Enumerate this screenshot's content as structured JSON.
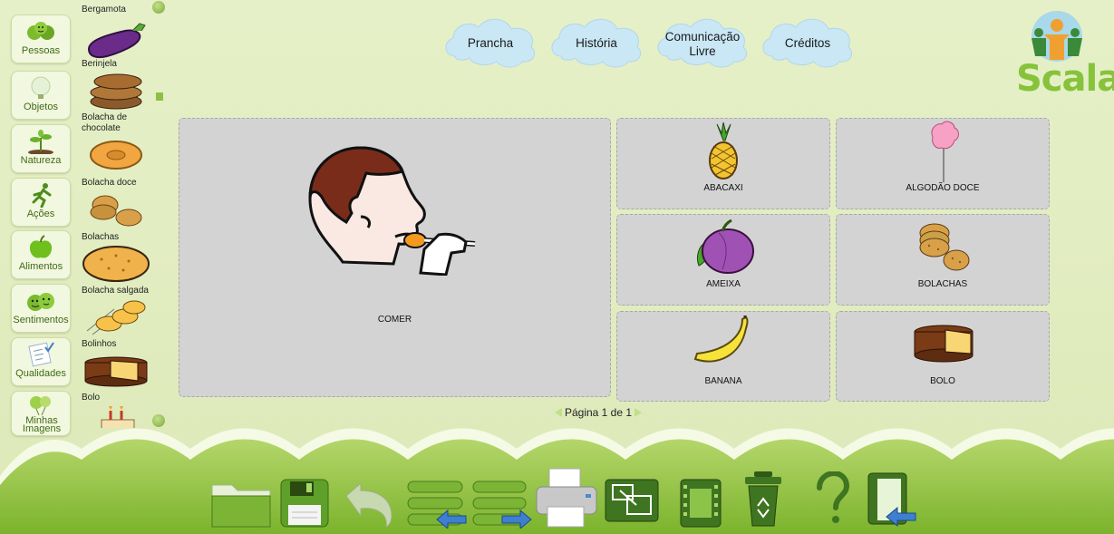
{
  "categories": [
    {
      "label": "Pessoas",
      "icon": "people-icon"
    },
    {
      "label": "Objetos",
      "icon": "lightbulb-icon"
    },
    {
      "label": "Natureza",
      "icon": "plant-icon"
    },
    {
      "label": "Ações",
      "icon": "running-icon"
    },
    {
      "label": "Alimentos",
      "icon": "apple-icon"
    },
    {
      "label": "Sentimentos",
      "icon": "faces-icon"
    },
    {
      "label": "Qualidades",
      "icon": "checklist-icon"
    },
    {
      "label": "Minhas Imagens",
      "icon": "balloons-icon"
    }
  ],
  "items": [
    {
      "label": "Bergamota"
    },
    {
      "label": "Berinjela"
    },
    {
      "label": "Bolacha de chocolate"
    },
    {
      "label": "Bolacha doce"
    },
    {
      "label": "Bolachas"
    },
    {
      "label": "Bolacha salgada"
    },
    {
      "label": "Bolinhos"
    },
    {
      "label": "Bolo"
    }
  ],
  "nav": {
    "prancha": "Prancha",
    "historia": "História",
    "comunicacao_1": "Comunicação",
    "comunicacao_2": "Livre",
    "creditos": "Créditos"
  },
  "logo": {
    "text": "Scala"
  },
  "board": {
    "main": {
      "label": "COMER",
      "icon": "boy-eating-icon"
    },
    "cells": [
      {
        "label": "ABACAXI",
        "icon": "pineapple-icon"
      },
      {
        "label": "ALGODÃO DOCE",
        "icon": "cotton-candy-icon"
      },
      {
        "label": "AMEIXA",
        "icon": "plum-icon"
      },
      {
        "label": "BOLACHAS",
        "icon": "cookies-icon"
      },
      {
        "label": "BANANA",
        "icon": "banana-icon"
      },
      {
        "label": "BOLO",
        "icon": "cake-icon"
      }
    ]
  },
  "pager": {
    "text": "Página 1 de 1"
  },
  "toolbar": [
    {
      "icon": "open-folder-icon"
    },
    {
      "icon": "save-icon"
    },
    {
      "icon": "undo-icon"
    },
    {
      "icon": "import-icon"
    },
    {
      "icon": "export-icon"
    },
    {
      "icon": "print-icon"
    },
    {
      "icon": "resize-icon"
    },
    {
      "icon": "film-icon"
    },
    {
      "icon": "recycle-bin-icon"
    },
    {
      "icon": "help-icon"
    },
    {
      "icon": "exit-icon"
    }
  ],
  "colors": {
    "background": "#e4efc4",
    "accent_green": "#7cb536",
    "cloud": "#c7e6f4",
    "tile": "#d3d3d3"
  }
}
